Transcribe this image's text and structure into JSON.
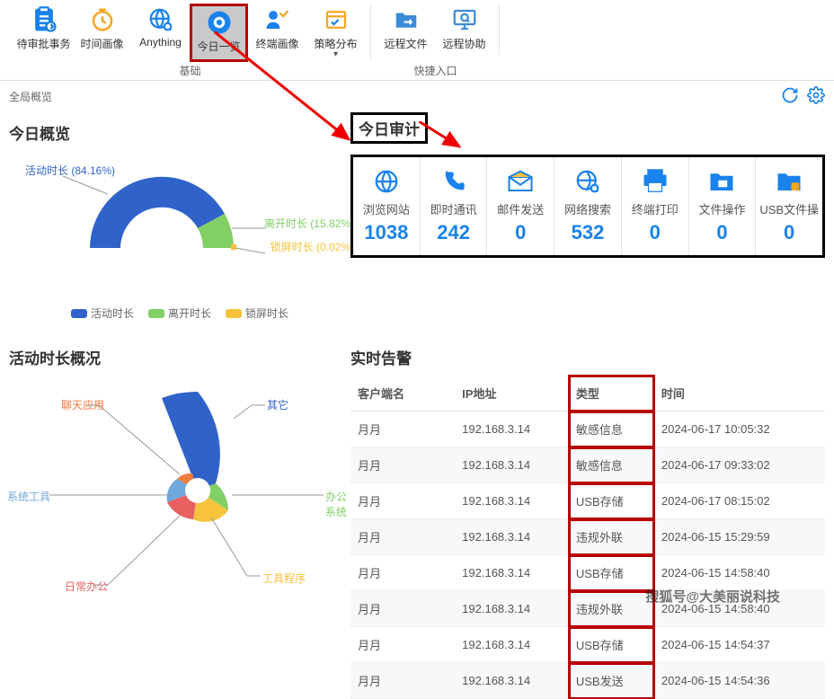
{
  "ribbon": {
    "groups": [
      {
        "title": "基础",
        "items": [
          {
            "label": "待审批事务",
            "icon": "clipboard-icon",
            "color": "#1a82ec"
          },
          {
            "label": "时间画像",
            "icon": "clock-icon",
            "color": "#f5a623"
          },
          {
            "label": "Anything",
            "icon": "globe-search-icon",
            "color": "#1a82ec"
          },
          {
            "label": "今日一览",
            "icon": "eye-icon",
            "color": "#1a82ec",
            "selected": true
          },
          {
            "label": "终端画像",
            "icon": "user-chart-icon",
            "color": "#1a82ec"
          },
          {
            "label": "策略分布",
            "icon": "board-check-icon",
            "color": "#f5a623",
            "more": true
          }
        ]
      },
      {
        "title": "快捷入口",
        "items": [
          {
            "label": "远程文件",
            "icon": "folder-arrow-icon",
            "color": "#3b8bd8"
          },
          {
            "label": "远程协助",
            "icon": "monitor-search-icon",
            "color": "#3b8bd8"
          }
        ]
      }
    ]
  },
  "breadcrumb": {
    "text": "全局概览"
  },
  "overview": {
    "title": "今日概览",
    "donut": {
      "slices": [
        {
          "name": "活动时长",
          "label": "活动时长 (84.16%)",
          "color": "#3063c9"
        },
        {
          "name": "离开时长",
          "label": "离开时长 (15.82%",
          "color": "#82cf66"
        },
        {
          "name": "锁屏时长",
          "label": "锁屏时长 (0.02%",
          "color": "#f7c23c"
        }
      ],
      "legend": [
        {
          "name": "活动时长",
          "color": "#3063c9"
        },
        {
          "name": "离开时长",
          "color": "#82cf66"
        },
        {
          "name": "锁屏时长",
          "color": "#f7c23c"
        }
      ]
    }
  },
  "audit": {
    "title": "今日审计",
    "stats": [
      {
        "label": "浏览网站",
        "value": "1038",
        "icon": "globe-icon"
      },
      {
        "label": "即时通讯",
        "value": "242",
        "icon": "phone-icon"
      },
      {
        "label": "邮件发送",
        "value": "0",
        "icon": "mail-icon"
      },
      {
        "label": "网络搜索",
        "value": "532",
        "icon": "search-globe-icon"
      },
      {
        "label": "终端打印",
        "value": "0",
        "icon": "printer-icon"
      },
      {
        "label": "文件操作",
        "value": "0",
        "icon": "folder-icon"
      },
      {
        "label": "USB文件操作",
        "value": "0",
        "icon": "usb-folder-icon"
      }
    ]
  },
  "activity": {
    "title": "活动时长概况",
    "slices": [
      {
        "name": "其它",
        "color": "#3063c9",
        "labelColor": "#3063c9"
      },
      {
        "name": "聊天应用",
        "color": "#f07b3f",
        "labelColor": "#f07b3f"
      },
      {
        "name": "办公系统",
        "color": "#82cf66",
        "labelColor": "#82cf66"
      },
      {
        "name": "系统工具",
        "color": "#6fa8dc",
        "labelColor": "#6fa8dc"
      },
      {
        "name": "工具程序",
        "color": "#f7c23c",
        "labelColor": "#f7c23c"
      },
      {
        "name": "日常办公",
        "color": "#e76160",
        "labelColor": "#e76160"
      }
    ]
  },
  "alerts": {
    "title": "实时告警",
    "columns": {
      "client": "客户端名",
      "ip": "IP地址",
      "type": "类型",
      "time": "时间"
    },
    "rows": [
      {
        "client": "月月",
        "ip": "192.168.3.14",
        "type": "敏感信息",
        "time": "2024-06-17 10:05:32"
      },
      {
        "client": "月月",
        "ip": "192.168.3.14",
        "type": "敏感信息",
        "time": "2024-06-17 09:33:02"
      },
      {
        "client": "月月",
        "ip": "192.168.3.14",
        "type": "USB存储",
        "time": "2024-06-17 08:15:02"
      },
      {
        "client": "月月",
        "ip": "192.168.3.14",
        "type": "违规外联",
        "time": "2024-06-15 15:29:59"
      },
      {
        "client": "月月",
        "ip": "192.168.3.14",
        "type": "USB存储",
        "time": "2024-06-15 14:58:40"
      },
      {
        "client": "月月",
        "ip": "192.168.3.14",
        "type": "违规外联",
        "time": "2024-06-15 14:58:40"
      },
      {
        "client": "月月",
        "ip": "192.168.3.14",
        "type": "USB存储",
        "time": "2024-06-15 14:54:37"
      },
      {
        "client": "月月",
        "ip": "192.168.3.14",
        "type": "USB发送",
        "time": "2024-06-15 14:54:36"
      }
    ]
  },
  "watermark": "搜狐号@大美丽说科技",
  "chart_data": [
    {
      "type": "pie",
      "title": "今日概览",
      "series": [
        {
          "name": "活动时长",
          "value": 84.16
        },
        {
          "name": "离开时长",
          "value": 15.82
        },
        {
          "name": "锁屏时长",
          "value": 0.02
        }
      ]
    },
    {
      "type": "pie",
      "title": "活动时长概况",
      "note": "values are relative radii (nightingale rose), estimated",
      "series": [
        {
          "name": "其它",
          "value": 100
        },
        {
          "name": "办公系统",
          "value": 35
        },
        {
          "name": "工具程序",
          "value": 25
        },
        {
          "name": "日常办公",
          "value": 30
        },
        {
          "name": "系统工具",
          "value": 20
        },
        {
          "name": "聊天应用",
          "value": 15
        }
      ]
    }
  ]
}
